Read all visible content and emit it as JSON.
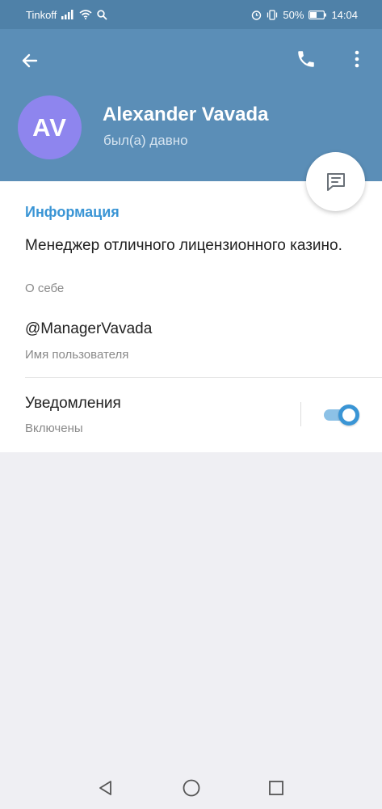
{
  "status_bar": {
    "carrier": "Tinkoff",
    "battery_percent": "50%",
    "time": "14:04",
    "icons": [
      "signal-icon",
      "wifi-icon",
      "search-icon",
      "alarm-icon",
      "vibrate-icon",
      "battery-icon"
    ]
  },
  "header": {
    "avatar_initials": "AV",
    "avatar_color": "#8e85ee",
    "name": "Alexander Vavada",
    "status": "был(а) давно",
    "background_color": "#5b8eb7",
    "icons": [
      "back-arrow-icon",
      "phone-icon",
      "more-vert-icon",
      "message-icon"
    ]
  },
  "info": {
    "section_title": "Информация",
    "bio": "Менеджер отличного лицензионного казино.",
    "bio_caption": "О себе",
    "username": "@ManagerVavada",
    "username_caption": "Имя пользователя"
  },
  "notifications": {
    "title": "Уведомления",
    "status": "Включены",
    "enabled": true,
    "accent_color": "#3a95d5"
  },
  "navbar": {
    "icons": [
      "back-triangle-icon",
      "home-circle-icon",
      "recents-square-icon"
    ]
  }
}
